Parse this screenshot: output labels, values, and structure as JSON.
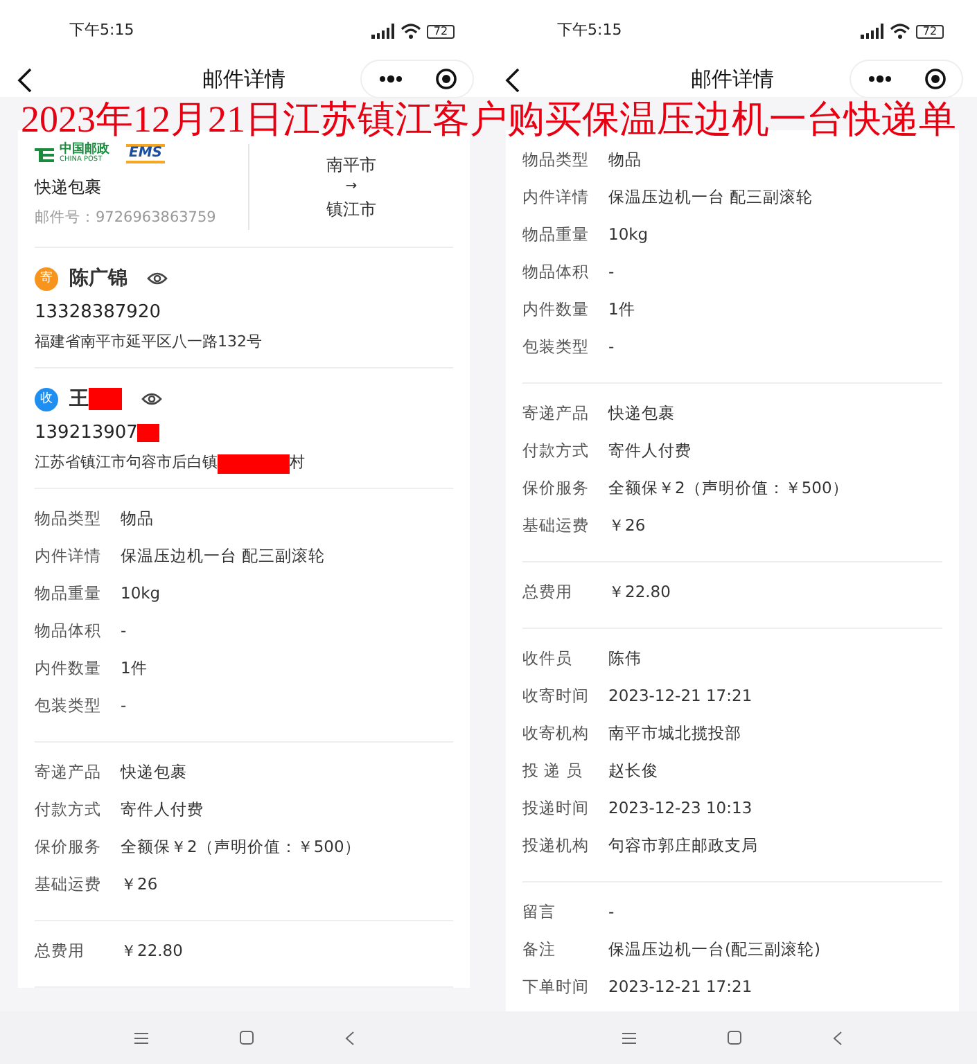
{
  "caption": "2023年12月21日江苏镇江客户购买保温压边机一台快递单",
  "panels": [
    {
      "status": {
        "time": "下午5:15",
        "battery": "72"
      },
      "nav": {
        "title": "邮件详情"
      },
      "sections": [
        {
          "kind": "header",
          "logo": {
            "name": "中国邮政",
            "name_en": "CHINA POST",
            "brand": "EMS"
          },
          "product": "快递包裹",
          "mail_no": "邮件号：9726963863759",
          "from": "南平市",
          "arrow": "→",
          "to": "镇江市"
        },
        {
          "kind": "party",
          "badge": "寄",
          "color": "#f7941d",
          "name": [
            {
              "kind": "text",
              "text": "陈广锦"
            }
          ],
          "phone": [
            {
              "kind": "text",
              "text": "13328387920"
            }
          ],
          "address": [
            {
              "kind": "text",
              "text": "福建省南平市延平区八一路132号"
            }
          ]
        },
        {
          "kind": "party",
          "badge": "收",
          "color": "#1e8ff0",
          "name": [
            {
              "kind": "text",
              "text": "王"
            },
            {
              "kind": "redaction"
            }
          ],
          "phone": [
            {
              "kind": "text",
              "text": "139213907"
            },
            {
              "kind": "redaction"
            }
          ],
          "address": [
            {
              "kind": "text",
              "text": "江苏省镇江市句容市后白镇"
            },
            {
              "kind": "redaction"
            },
            {
              "kind": "text",
              "text": "村"
            }
          ]
        },
        {
          "kind": "fields",
          "rows": [
            {
              "label": "物品类型",
              "value": "物品"
            },
            {
              "label": "内件详情",
              "value": "保温压边机一台 配三副滚轮"
            },
            {
              "label": "物品重量",
              "value": "10kg"
            },
            {
              "label": "物品体积",
              "value": "-"
            },
            {
              "label": "内件数量",
              "value": "1件"
            },
            {
              "label": "包装类型",
              "value": "-"
            }
          ]
        },
        {
          "kind": "fields",
          "rows": [
            {
              "label": "寄递产品",
              "value": "快递包裹"
            },
            {
              "label": "付款方式",
              "value": "寄件人付费"
            },
            {
              "label": "保价服务",
              "value": "全额保￥2（声明价值：￥500）"
            },
            {
              "label": "基础运费",
              "value": "￥26"
            }
          ]
        },
        {
          "kind": "fields",
          "rows": [
            {
              "label": "总费用",
              "value": "￥22.80"
            }
          ]
        }
      ]
    },
    {
      "status": {
        "time": "下午5:15",
        "battery": "72"
      },
      "nav": {
        "title": "邮件详情"
      },
      "sections": [
        {
          "kind": "fields",
          "rows": [
            {
              "label": "物品类型",
              "value": "物品"
            },
            {
              "label": "内件详情",
              "value": "保温压边机一台 配三副滚轮"
            },
            {
              "label": "物品重量",
              "value": "10kg"
            },
            {
              "label": "物品体积",
              "value": "-"
            },
            {
              "label": "内件数量",
              "value": "1件"
            },
            {
              "label": "包装类型",
              "value": "-"
            }
          ]
        },
        {
          "kind": "fields",
          "rows": [
            {
              "label": "寄递产品",
              "value": "快递包裹"
            },
            {
              "label": "付款方式",
              "value": "寄件人付费"
            },
            {
              "label": "保价服务",
              "value": "全额保￥2（声明价值：￥500）"
            },
            {
              "label": "基础运费",
              "value": "￥26"
            }
          ]
        },
        {
          "kind": "fields",
          "rows": [
            {
              "label": "总费用",
              "value": "￥22.80"
            }
          ]
        },
        {
          "kind": "fields",
          "rows": [
            {
              "label": "收件员",
              "value": "陈伟"
            },
            {
              "label": "收寄时间",
              "value": "2023-12-21 17:21"
            },
            {
              "label": "收寄机构",
              "value": "南平市城北揽投部"
            },
            {
              "label": "投 递 员",
              "value": "赵长俊"
            },
            {
              "label": "投递时间",
              "value": "2023-12-23 10:13"
            },
            {
              "label": "投递机构",
              "value": "句容市郭庄邮政支局"
            }
          ]
        },
        {
          "kind": "fields",
          "rows": [
            {
              "label": "留言",
              "value": "-"
            },
            {
              "label": "备注",
              "value": "保温压边机一台(配三副滚轮)"
            },
            {
              "label": "下单时间",
              "value": "2023-12-21 17:21"
            }
          ]
        }
      ]
    }
  ]
}
